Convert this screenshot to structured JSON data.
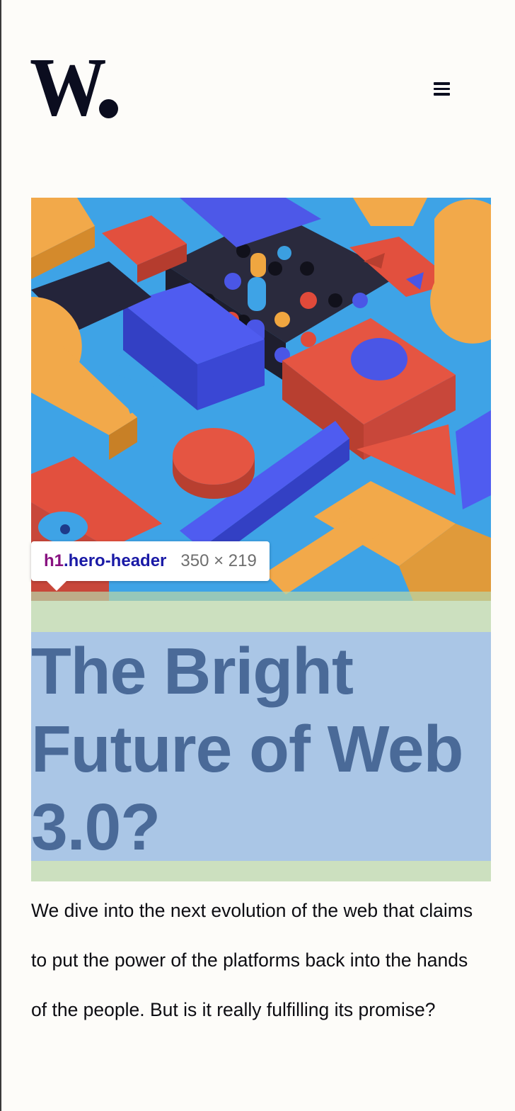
{
  "header": {
    "logo_text": "W",
    "menu_icon": "hamburger-menu-icon"
  },
  "hero": {
    "image_description_icon": "abstract-3d-blocks-illustration",
    "title": "The Bright Future of Web 3.0?",
    "intro": "We dive into the next evolution of the web that claims to put the power of the platforms back into the hands of the people. But is it really fulfilling its promise?"
  },
  "devtools": {
    "tag": "h1",
    "class": ".hero-header",
    "dimensions": "350 × 219"
  },
  "colors": {
    "background": "#fdfcf9",
    "ink": "#0b0d1f",
    "highlight_content": "#9ebee2",
    "highlight_margin": "#b8d6a8",
    "heading_overlay_text": "#4a6a98"
  }
}
